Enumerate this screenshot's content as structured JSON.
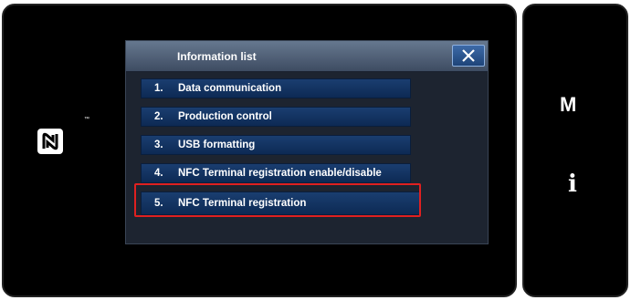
{
  "dialog": {
    "title": "Information list",
    "close_label": "X",
    "items": [
      {
        "num": "1.",
        "label": "Data communication"
      },
      {
        "num": "2.",
        "label": "Production control"
      },
      {
        "num": "3.",
        "label": "USB formatting"
      },
      {
        "num": "4.",
        "label": "NFC Terminal registration enable/disable"
      },
      {
        "num": "5.",
        "label": "NFC Terminal registration",
        "highlighted": true
      }
    ]
  },
  "side_buttons": {
    "mode_label": "M",
    "info_label": "i"
  },
  "nfc_mark": {
    "icon": "nfc-icon",
    "tm": "™"
  },
  "colors": {
    "highlight": "#e02020",
    "item_bg": "#1a3e70",
    "title_bar": "#66788f"
  }
}
